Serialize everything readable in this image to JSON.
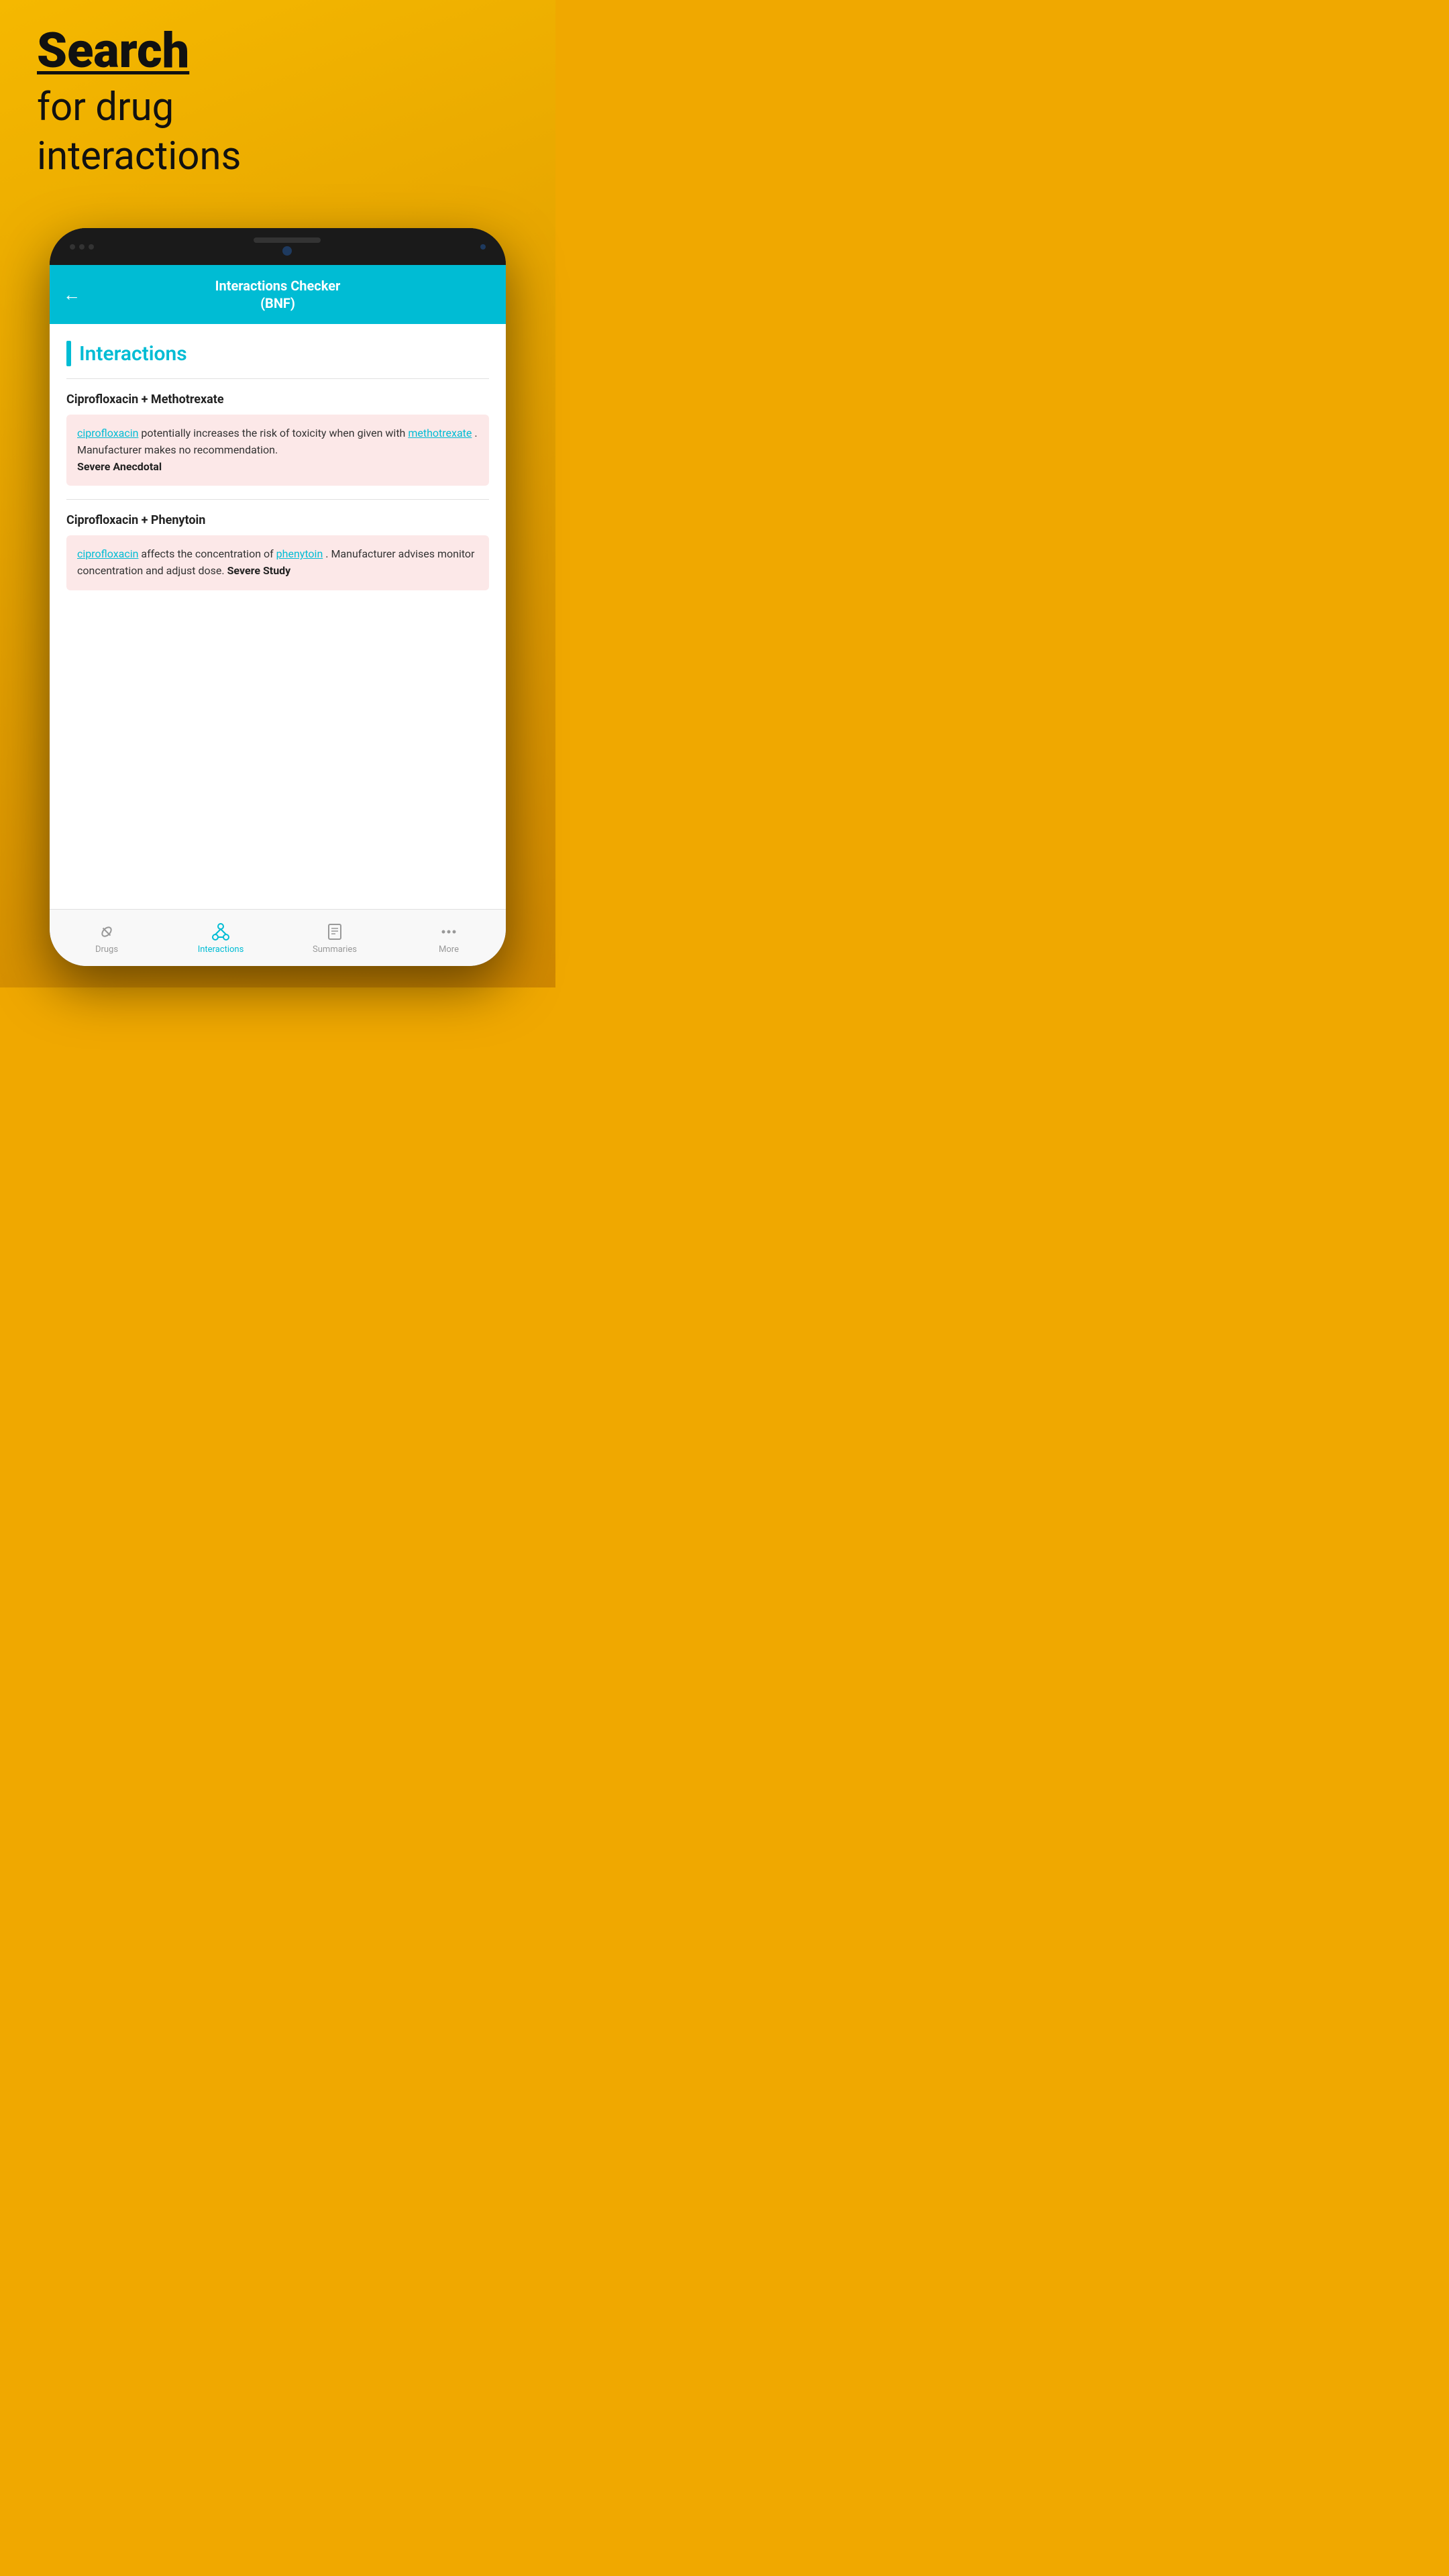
{
  "background": {
    "color": "#F0A800"
  },
  "header": {
    "search_word": "Search",
    "subtitle": "for drug\ninteractions"
  },
  "phone": {
    "app_header": {
      "title": "Interactions Checker\n(BNF)",
      "back_icon": "←"
    },
    "content": {
      "section_title": "Interactions",
      "interactions": [
        {
          "title": "Ciprofloxacin + Methotrexate",
          "text_before_link1": "",
          "link1": "ciprofloxacin",
          "text_middle": " potentially increases the risk of toxicity when given with ",
          "link2": "methotrexate",
          "text_after": ". Manufacturer makes no recommendation.",
          "severity": "Severe Anecdotal"
        },
        {
          "title": "Ciprofloxacin + Phenytoin",
          "text_before_link1": "",
          "link1": "ciprofloxacin",
          "text_middle": " affects the concentration of ",
          "link2": "phenytoin",
          "text_after": ". Manufacturer advises monitor concentration and adjust dose.",
          "severity": "Severe Study"
        }
      ]
    },
    "bottom_nav": {
      "items": [
        {
          "id": "drugs",
          "label": "Drugs",
          "active": false
        },
        {
          "id": "interactions",
          "label": "Interactions",
          "active": true
        },
        {
          "id": "summaries",
          "label": "Summaries",
          "active": false
        },
        {
          "id": "more",
          "label": "More",
          "active": false
        }
      ]
    }
  }
}
